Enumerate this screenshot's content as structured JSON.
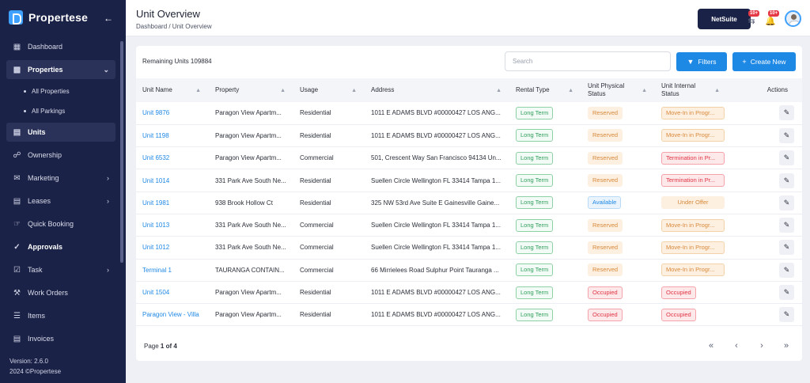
{
  "sidebar": {
    "brand": "Propertese",
    "items": [
      {
        "label": "Dashboard",
        "icon": "dashboard-icon"
      },
      {
        "label": "Properties",
        "icon": "properties-icon"
      },
      {
        "label": "All Properties"
      },
      {
        "label": "All Parkings"
      },
      {
        "label": "Units",
        "icon": "units-icon"
      },
      {
        "label": "Ownership",
        "icon": "ownership-icon"
      },
      {
        "label": "Marketing",
        "icon": "megaphone-icon"
      },
      {
        "label": "Leases",
        "icon": "leases-icon"
      },
      {
        "label": "Quick Booking",
        "icon": "quick-booking-icon"
      },
      {
        "label": "Approvals",
        "icon": "approvals-icon"
      },
      {
        "label": "Task",
        "icon": "task-icon"
      },
      {
        "label": "Work Orders",
        "icon": "work-orders-icon"
      },
      {
        "label": "Items",
        "icon": "items-icon"
      },
      {
        "label": "Invoices",
        "icon": "invoices-icon"
      }
    ],
    "version": "Version: 2.6.0",
    "copyright": "2024 ©Propertese"
  },
  "header": {
    "title": "Unit Overview",
    "breadcrumb": "Dashboard / Unit Overview",
    "netsuite_label": "NetSuite",
    "badge1": "10+",
    "badge2": "10+"
  },
  "toolbar": {
    "remaining": "Remaining Units 109884",
    "search_placeholder": "Search",
    "filters_label": "Filters",
    "create_label": "Create New"
  },
  "table": {
    "columns": [
      "Unit Name",
      "Property",
      "Usage",
      "Address",
      "Rental Type",
      "Unit Physical Status",
      "Unit Internal Status",
      "Actions"
    ],
    "rows": [
      {
        "unit": "Unit 9876",
        "property": "Paragon View Apartm...",
        "usage": "Residential",
        "address": "1011 E ADAMS BLVD #00000427 LOS ANG...",
        "rental": "Long Term",
        "physical": "Reserved",
        "internal": "Move-In in Progr..."
      },
      {
        "unit": "Unit 1198",
        "property": "Paragon View Apartm...",
        "usage": "Residential",
        "address": "1011 E ADAMS BLVD #00000427 LOS ANG...",
        "rental": "Long Term",
        "physical": "Reserved",
        "internal": "Move-In in Progr..."
      },
      {
        "unit": "Unit 6532",
        "property": "Paragon View Apartm...",
        "usage": "Commercial",
        "address": "501, Crescent Way San Francisco 94134 Un...",
        "rental": "Long Term",
        "physical": "Reserved",
        "internal": "Termination in Pr..."
      },
      {
        "unit": "Unit 1014",
        "property": "331 Park Ave South Ne...",
        "usage": "Residential",
        "address": "Suellen Circle Wellington FL 33414 Tampa 1...",
        "rental": "Long Term",
        "physical": "Reserved",
        "internal": "Termination in Pr..."
      },
      {
        "unit": "Unit 1981",
        "property": "938 Brook Hollow Ct",
        "usage": "Residential",
        "address": "325 NW 53rd Ave Suite E Gainesville Gaine...",
        "rental": "Long Term",
        "physical": "Available",
        "internal": "Under Offer"
      },
      {
        "unit": "Unit 1013",
        "property": "331 Park Ave South Ne...",
        "usage": "Commercial",
        "address": "Suellen Circle Wellington FL 33414 Tampa 1...",
        "rental": "Long Term",
        "physical": "Reserved",
        "internal": "Move-In in Progr..."
      },
      {
        "unit": "Unit 1012",
        "property": "331 Park Ave South Ne...",
        "usage": "Commercial",
        "address": "Suellen Circle Wellington FL 33414 Tampa 1...",
        "rental": "Long Term",
        "physical": "Reserved",
        "internal": "Move-In in Progr..."
      },
      {
        "unit": "Terminal 1",
        "property": "TAURANGA CONTAIN...",
        "usage": "Commercial",
        "address": "66 Mirrielees Road Sulphur Point Tauranga ...",
        "rental": "Long Term",
        "physical": "Reserved",
        "internal": "Move-In in Progr..."
      },
      {
        "unit": "Unit 1504",
        "property": "Paragon View Apartm...",
        "usage": "Residential",
        "address": "1011 E ADAMS BLVD #00000427 LOS ANG...",
        "rental": "Long Term",
        "physical": "Occupied",
        "internal": "Occupied"
      },
      {
        "unit": "Paragon View - Villa",
        "property": "Paragon View Apartm...",
        "usage": "Residential",
        "address": "1011 E ADAMS BLVD #00000427 LOS ANG...",
        "rental": "Long Term",
        "physical": "Occupied",
        "internal": "Occupied"
      }
    ]
  },
  "pagination": {
    "prefix": "Page",
    "current": "1 of 4"
  },
  "colors": {
    "sidebar_bg": "#1b2247",
    "accent": "#1e88e5",
    "badge": "#e53946"
  }
}
